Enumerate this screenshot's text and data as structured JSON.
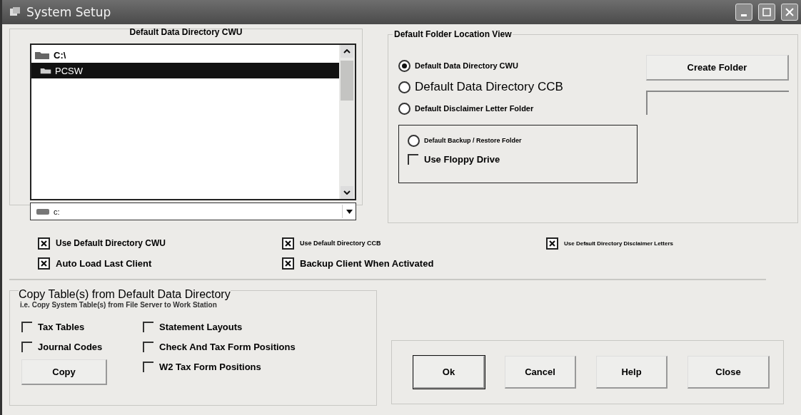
{
  "window": {
    "title": "System Setup"
  },
  "directory_group": {
    "title": "Default Data Directory CWU",
    "folders": [
      {
        "label": "C:\\",
        "selected": false,
        "kind": "open"
      },
      {
        "label": "PCSW",
        "selected": true,
        "kind": "sub"
      }
    ],
    "drive": {
      "value": "c:"
    }
  },
  "folder_view": {
    "title": "Default Folder Location View",
    "options": [
      {
        "label": "Default Data Directory CWU",
        "selected": true
      },
      {
        "label": "Default Data Directory CCB",
        "selected": false
      },
      {
        "label": "Default Disclaimer Letter Folder",
        "selected": false
      }
    ],
    "backup": {
      "option": {
        "label": "Default Backup / Restore Folder",
        "selected": false
      },
      "floppy": {
        "label": "Use Floppy Drive",
        "checked": false
      }
    },
    "create_button": "Create Folder"
  },
  "options": [
    {
      "label": "Use Default Directory CWU",
      "checked": true
    },
    {
      "label": "Use Default Directory CCB",
      "checked": true
    },
    {
      "label": "Use Default Directory Disclaimer Letters",
      "checked": true
    },
    {
      "label": "Auto Load Last Client",
      "checked": true
    },
    {
      "label": "Backup Client When Activated",
      "checked": true
    }
  ],
  "copy_group": {
    "title": "Copy Table(s) from Default Data Directory",
    "subtitle": "i.e. Copy System Table(s)  from File Server to Work Station",
    "tables": [
      {
        "label": "Tax Tables",
        "checked": false
      },
      {
        "label": "Statement Layouts",
        "checked": false
      },
      {
        "label": "Journal Codes",
        "checked": false
      },
      {
        "label": "Check And Tax Form Positions",
        "checked": false
      },
      {
        "label": "W2 Tax Form Positions",
        "checked": false
      }
    ],
    "copy_button": "Copy"
  },
  "buttons": [
    {
      "label": "Ok",
      "default": true
    },
    {
      "label": "Cancel",
      "default": false
    },
    {
      "label": "Help",
      "default": false
    },
    {
      "label": "Close",
      "default": false
    }
  ]
}
